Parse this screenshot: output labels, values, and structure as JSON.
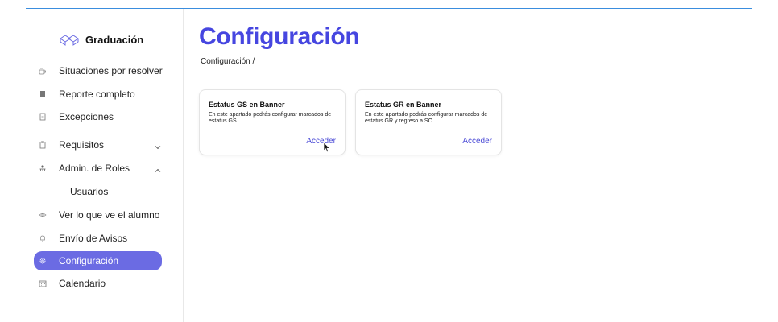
{
  "app": {
    "name": "Graduación",
    "accent_color": "#4646e0",
    "active_color": "#6b6be3"
  },
  "sidebar": {
    "items": [
      {
        "label": "Situaciones por resolver",
        "icon": "coffee-icon"
      },
      {
        "label": "Reporte completo",
        "icon": "report-icon"
      },
      {
        "label": "Excepciones",
        "icon": "document-icon"
      },
      {
        "label": "Requisitos",
        "icon": "clipboard-icon",
        "chevron": "chevron-down-icon"
      },
      {
        "label": "Admin. de Roles",
        "icon": "users-icon",
        "chevron": "chevron-up-icon"
      },
      {
        "label": "Usuarios",
        "sub": true
      },
      {
        "label": "Ver lo que ve el alumno",
        "icon": "eye-icon"
      },
      {
        "label": "Envío de Avisos",
        "icon": "bell-icon"
      },
      {
        "label": "Configuración",
        "icon": "gear-icon",
        "active": true
      },
      {
        "label": "Calendario",
        "icon": "calendar-icon"
      }
    ]
  },
  "main": {
    "title": "Configuración",
    "breadcrumb": "Configuración /",
    "cards": [
      {
        "title": "Estatus GS en Banner",
        "description": "En este apartado podrás configurar marcados de estatus GS.",
        "link": "Acceder"
      },
      {
        "title": "Estatus GR en Banner",
        "description": "En este apartado podrás configurar marcados de estatus GR y regreso a SO.",
        "link": "Acceder"
      }
    ]
  }
}
